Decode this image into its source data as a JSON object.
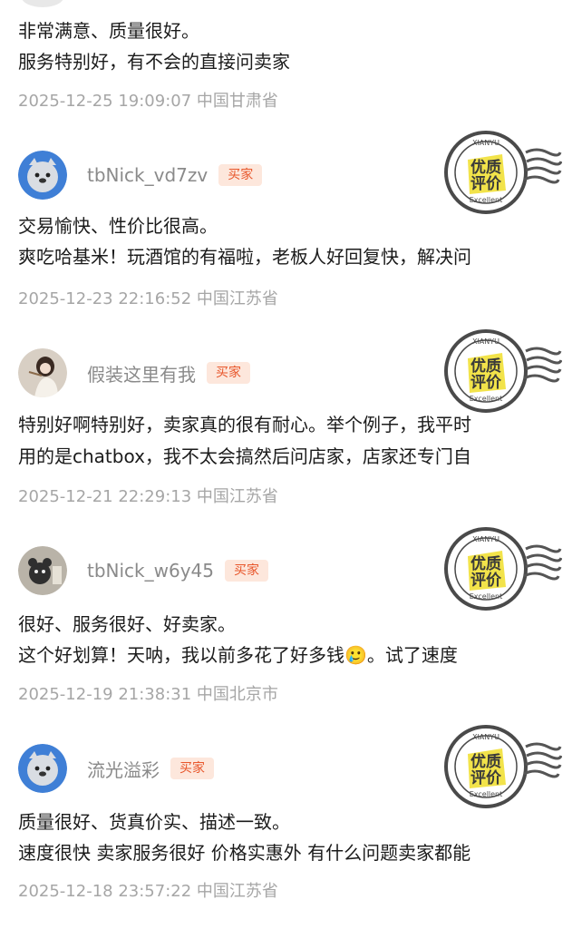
{
  "colors": {
    "badge_text": "#e8572c",
    "badge_bg": "#fde7dc",
    "time_text": "#a6a6a6",
    "username_text": "#8a8a8a",
    "stamp_yellow": "#f2e34a"
  },
  "stamp": {
    "top_text": "XIANYU",
    "main_text_1": "优质",
    "main_text_2": "评价",
    "bottom_text": "Excellent"
  },
  "reviews": [
    {
      "lines": [
        "非常满意、质量很好。",
        "服务特别好，有不会的直接问卖家"
      ],
      "time": "2025-12-25 19:09:07  中国甘肃省"
    },
    {
      "username": "tbNick_vd7zv",
      "badge": "买家",
      "avatar_icon": "seal-avatar-icon",
      "lines": [
        "交易愉快、性价比很高。",
        "爽吃哈基米！玩酒馆的有福啦，老板人好回复快，解决问"
      ],
      "time": "2025-12-23 22:16:52  中国江苏省"
    },
    {
      "username": "假装这里有我",
      "badge": "买家",
      "avatar_icon": "girl-avatar-icon",
      "lines": [
        "特别好啊特别好，卖家真的很有耐心。举个例子，我平时",
        "用的是chatbox，我不太会搞然后问店家，店家还专门自"
      ],
      "time": "2025-12-21 22:29:13  中国江苏省"
    },
    {
      "username": "tbNick_w6y45",
      "badge": "买家",
      "avatar_icon": "bear-avatar-icon",
      "lines": [
        "很好、服务很好、好卖家。",
        "这个好划算！天呐，我以前多花了好多钱🥲。试了速度"
      ],
      "time": "2025-12-19 21:38:31  中国北京市"
    },
    {
      "username": "流光溢彩",
      "badge": "买家",
      "avatar_icon": "seal-avatar-icon",
      "lines": [
        "质量很好、货真价实、描述一致。",
        "速度很快 卖家服务很好 价格实惠外 有什么问题卖家都能"
      ],
      "time": "2025-12-18 23:57:22  中国江苏省"
    }
  ]
}
